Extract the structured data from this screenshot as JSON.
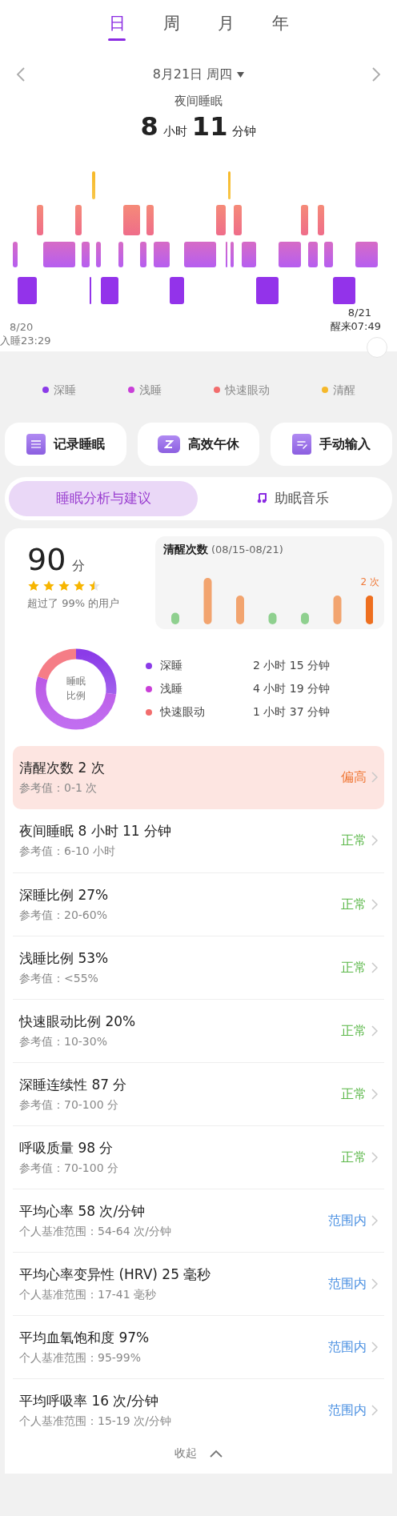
{
  "period_tabs": [
    {
      "label": "日",
      "selected": true
    },
    {
      "label": "周",
      "selected": false
    },
    {
      "label": "月",
      "selected": false
    },
    {
      "label": "年",
      "selected": false
    }
  ],
  "date": "8月21日 周四",
  "summary": {
    "title": "夜间睡眠",
    "hours": "8",
    "hours_unit": "小时",
    "minutes": "11",
    "minutes_unit": "分钟"
  },
  "hypnogram": {
    "start_date": "8/20",
    "start_time": "入睡23:29",
    "end_date": "8/21",
    "end_time": "醒来07:49"
  },
  "legend": [
    {
      "label": "深睡",
      "color": "#8b3be8"
    },
    {
      "label": "浅睡",
      "color": "#c93fd8"
    },
    {
      "label": "快速眼动",
      "color": "#f26d6d"
    },
    {
      "label": "清醒",
      "color": "#f5b82b"
    }
  ],
  "actions": [
    {
      "label": "记录睡眠",
      "kind": "record"
    },
    {
      "label": "高效午休",
      "kind": "nap"
    },
    {
      "label": "手动输入",
      "kind": "manual"
    }
  ],
  "segments": [
    {
      "label": "睡眠分析与建议",
      "selected": true,
      "kind": "text"
    },
    {
      "label": "助眠音乐",
      "selected": false,
      "kind": "music"
    }
  ],
  "score": {
    "value": "90",
    "unit": "分",
    "stars": 4.5,
    "rank": "超过了 99% 的用户"
  },
  "wake_count": {
    "title": "清醒次数",
    "range": "(08/15-08/21)",
    "last_label": "2 次"
  },
  "ratio": {
    "center_label": "睡眠比例",
    "items": [
      {
        "label": "深睡",
        "value": "2 小时 15 分钟",
        "color": "#8b3be8"
      },
      {
        "label": "浅睡",
        "value": "4 小时 19 分钟",
        "color": "#c93fd8"
      },
      {
        "label": "快速眼动",
        "value": "1 小时 37 分钟",
        "color": "#f26d6d"
      }
    ]
  },
  "metrics": [
    {
      "title": "清醒次数 2 次",
      "reference": "参考值：0-1 次",
      "status": "偏高",
      "kind": "high"
    },
    {
      "title": "夜间睡眠 8 小时 11 分钟",
      "reference": "参考值：6-10 小时",
      "status": "正常",
      "kind": "normal"
    },
    {
      "title": "深睡比例 27%",
      "reference": "参考值：20-60%",
      "status": "正常",
      "kind": "normal"
    },
    {
      "title": "浅睡比例 53%",
      "reference": "参考值：<55%",
      "status": "正常",
      "kind": "normal"
    },
    {
      "title": "快速眼动比例 20%",
      "reference": "参考值：10-30%",
      "status": "正常",
      "kind": "normal"
    },
    {
      "title": "深睡连续性 87 分",
      "reference": "参考值：70-100 分",
      "status": "正常",
      "kind": "normal"
    },
    {
      "title": "呼吸质量 98 分",
      "reference": "参考值：70-100 分",
      "status": "正常",
      "kind": "normal"
    },
    {
      "title": "平均心率 58 次/分钟",
      "reference": "个人基准范围：54-64 次/分钟",
      "status": "范围内",
      "kind": "in_range"
    },
    {
      "title": "平均心率变异性 (HRV) 25 毫秒",
      "reference": "个人基准范围：17-41 毫秒",
      "status": "范围内",
      "kind": "in_range"
    },
    {
      "title": "平均血氧饱和度 97%",
      "reference": "个人基准范围：95-99%",
      "status": "范围内",
      "kind": "in_range"
    },
    {
      "title": "平均呼吸率 16 次/分钟",
      "reference": "个人基准范围：15-19 次/分钟",
      "status": "范围内",
      "kind": "in_range"
    }
  ],
  "collapse": "收起"
}
